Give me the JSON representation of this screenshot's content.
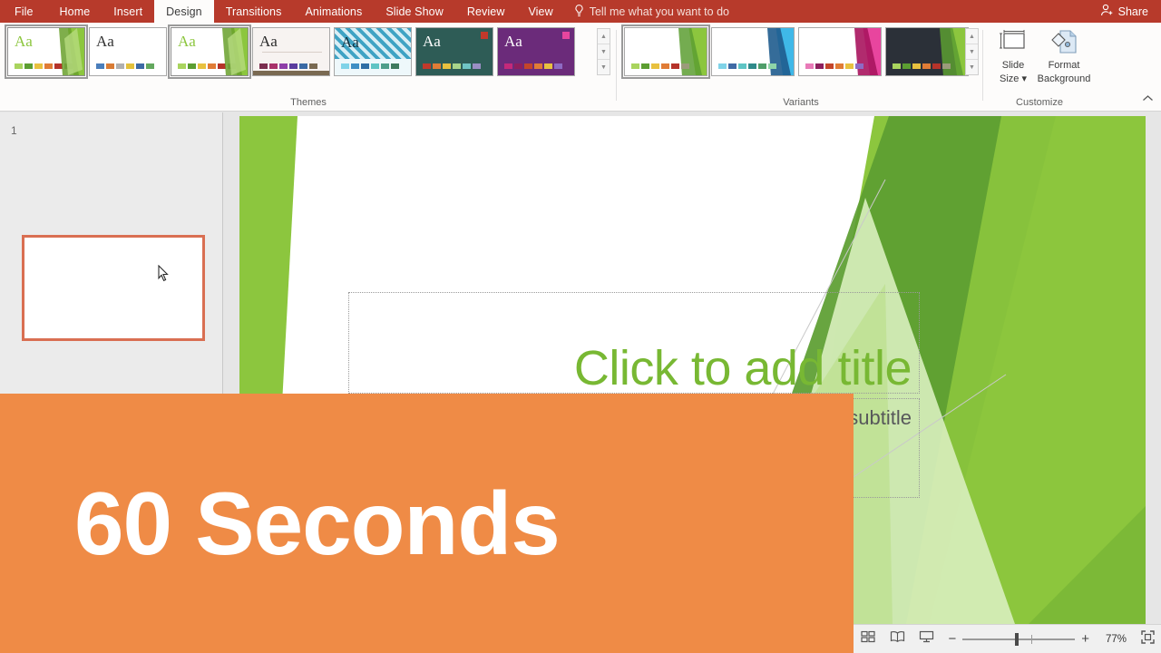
{
  "ribbon": {
    "tabs": [
      {
        "label": "File",
        "active": false
      },
      {
        "label": "Home",
        "active": false
      },
      {
        "label": "Insert",
        "active": false
      },
      {
        "label": "Design",
        "active": true
      },
      {
        "label": "Transitions",
        "active": false
      },
      {
        "label": "Animations",
        "active": false
      },
      {
        "label": "Slide Show",
        "active": false
      },
      {
        "label": "Review",
        "active": false
      },
      {
        "label": "View",
        "active": false
      }
    ],
    "tell_me": "Tell me what you want to do",
    "tell_me_icon": "lightbulb-icon",
    "share": "Share",
    "share_icon": "person-add-icon",
    "collapse_icon": "chevron-up-icon",
    "bar_color": "#b73a2b"
  },
  "themes": {
    "group_label": "Themes",
    "items": [
      {
        "name": "facet-green-theme",
        "aa": "Aa",
        "aa_color": "#8cc63e",
        "bg": "#ffffff",
        "facet": true,
        "swatches": [
          "#a9d45e",
          "#5c9e31",
          "#e8c13f",
          "#e07c36",
          "#b5332a",
          "#9b9b7a"
        ],
        "selected": false
      },
      {
        "name": "office-theme",
        "aa": "Aa",
        "aa_color": "#333333",
        "bg": "#ffffff",
        "facet": false,
        "swatches": [
          "#4a7ebb",
          "#d97c35",
          "#b0b0b0",
          "#e3c13c",
          "#3d6aa5",
          "#63a85e"
        ],
        "selected": false
      },
      {
        "name": "facet-green-theme-2",
        "aa": "Aa",
        "aa_color": "#8cc63e",
        "bg": "#ffffff",
        "facet": true,
        "swatches": [
          "#a9d45e",
          "#5c9e31",
          "#e8c13f",
          "#e07c36",
          "#b5332a",
          "#9b9b7a"
        ],
        "selected": true
      },
      {
        "name": "wisp-theme",
        "aa": "Aa",
        "aa_color": "#2b2b2b",
        "bg": "#f7f3f1",
        "facet": false,
        "swatches": [
          "#7b2d4e",
          "#a8316a",
          "#8e3ea8",
          "#5a3c9e",
          "#3a6aa5",
          "#7a6a52"
        ],
        "selected": false
      },
      {
        "name": "berlin-pattern-theme",
        "aa": "Aa",
        "aa_color": "#1a3d52",
        "bg": "#3fa3c4",
        "facet": false,
        "swatches": [
          "#7fd3e8",
          "#3f8fc4",
          "#2f6fa5",
          "#5ec4c4",
          "#4f9e8a",
          "#3f7a5e"
        ],
        "selected": false
      },
      {
        "name": "dark-teal-theme",
        "aa": "Aa",
        "aa_color": "#ffffff",
        "bg": "#2e5c56",
        "facet": false,
        "swatches": [
          "#c0392b",
          "#e07c36",
          "#e8c13f",
          "#a8d48a",
          "#6fc4c4",
          "#9a8ec4"
        ],
        "selected": false
      },
      {
        "name": "purple-theme",
        "aa": "Aa",
        "aa_color": "#ffffff",
        "bg": "#6b2b7a",
        "facet": false,
        "swatches": [
          "#c4297a",
          "#8e1f5e",
          "#c44a2a",
          "#e07c36",
          "#e8c13f",
          "#8e6ac4"
        ],
        "selected": false
      }
    ],
    "scroll_up_icon": "scroll-up-icon",
    "scroll_down_icon": "scroll-down-icon",
    "more_icon": "gallery-more-icon"
  },
  "variants": {
    "group_label": "Variants",
    "items": [
      {
        "name": "variant-green",
        "accent": "#8cc63e",
        "dark": "#5c9e31",
        "bg": "#ffffff",
        "swatches": [
          "#a9d45e",
          "#5c9e31",
          "#e8c13f",
          "#e07c36",
          "#b5332a",
          "#9b9b7a"
        ],
        "selected": true
      },
      {
        "name": "variant-blue",
        "accent": "#3fb8e8",
        "dark": "#1f5c8e",
        "bg": "#ffffff",
        "swatches": [
          "#7fd3e8",
          "#3f6aa5",
          "#5ec4c4",
          "#2f8a8a",
          "#4f9e6a",
          "#8ed4a8"
        ],
        "selected": false
      },
      {
        "name": "variant-pink",
        "accent": "#e8459e",
        "dark": "#a8145e",
        "bg": "#ffffff",
        "swatches": [
          "#e87ab8",
          "#8e1f5e",
          "#c4452a",
          "#e07c36",
          "#e8c13f",
          "#8e6ac4"
        ],
        "selected": false
      },
      {
        "name": "variant-dark",
        "accent": "#8cc63e",
        "dark": "#5c9e31",
        "bg": "#2b3038",
        "swatches": [
          "#a9d45e",
          "#5c9e31",
          "#e8c13f",
          "#e07c36",
          "#b5332a",
          "#9b9b7a"
        ],
        "selected": false
      }
    ],
    "scroll_up_icon": "scroll-up-icon",
    "scroll_down_icon": "scroll-down-icon",
    "more_icon": "gallery-more-icon"
  },
  "customize": {
    "group_label": "Customize",
    "slide_size": "Slide\nSize",
    "slide_size_line1": "Slide",
    "slide_size_line2": "Size",
    "slide_size_icon": "slide-size-icon",
    "format_background_line1": "Format",
    "format_background_line2": "Background",
    "format_background_icon": "format-background-icon"
  },
  "thumbnail_pane": {
    "slide_number": "1",
    "selected_border_color": "#d96f52",
    "cursor_icon": "mouse-pointer-icon"
  },
  "slide": {
    "title_placeholder": "Click to add title",
    "title_color": "#78b833",
    "subtitle_placeholder": "Click to add subtitle",
    "subtitle_color": "#57585a",
    "theme_name": "facet-green"
  },
  "status_bar": {
    "views": [
      {
        "name": "normal-view-button",
        "icon": "normal-view-icon",
        "active": true
      },
      {
        "name": "slide-sorter-button",
        "icon": "slide-sorter-icon",
        "active": false
      },
      {
        "name": "reading-view-button",
        "icon": "reading-view-icon",
        "active": false
      },
      {
        "name": "slide-show-button",
        "icon": "slide-show-icon",
        "active": false
      }
    ],
    "zoom_out": "−",
    "zoom_in": "+",
    "zoom_level": "77%",
    "fit_icon": "fit-to-window-icon"
  },
  "overlay": {
    "text": "60 Seconds",
    "bg_color": "#ef8b46",
    "text_color": "#ffffff"
  }
}
